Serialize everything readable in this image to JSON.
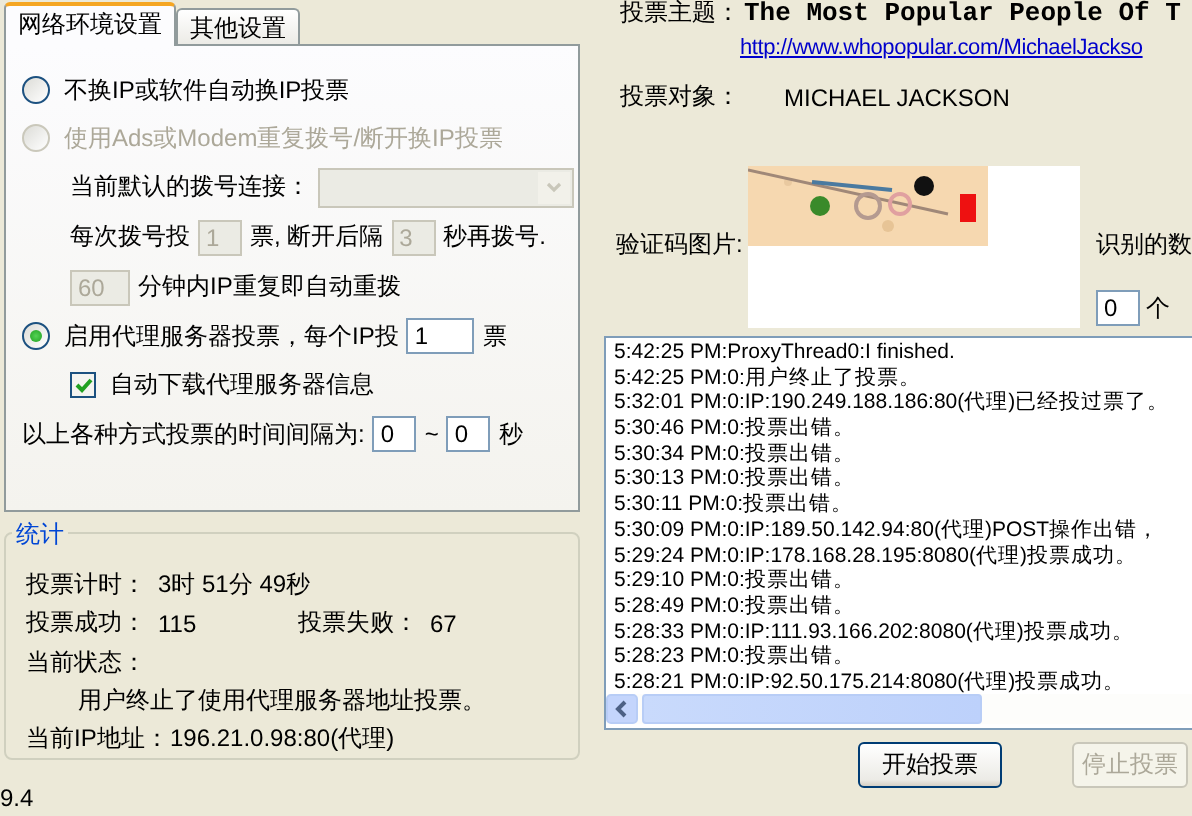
{
  "settings_tabs": [
    {
      "label": "网络环境设置",
      "selected": true
    },
    {
      "label": "其他设置",
      "selected": false
    }
  ],
  "network_settings": [
    {
      "kind": "radio",
      "selected": false,
      "disabled": false,
      "parts": [
        {
          "kind": "text",
          "text": "不换IP或软件自动换IP投票"
        }
      ]
    },
    {
      "kind": "radio",
      "selected": false,
      "disabled": true,
      "parts": [
        {
          "kind": "text",
          "text": "使用Ads或Modem重复拨号/断开换IP投票"
        }
      ],
      "children": [
        {
          "kind": "row",
          "parts": [
            {
              "kind": "text",
              "text": "当前默认的拨号连接："
            },
            {
              "kind": "select",
              "disabled": true
            }
          ]
        },
        {
          "kind": "row",
          "parts": [
            {
              "kind": "text",
              "text": "每次拨号投"
            },
            {
              "kind": "input",
              "value": "1",
              "disabled": true
            },
            {
              "kind": "text",
              "text": "票, 断开后隔"
            },
            {
              "kind": "input",
              "value": "3",
              "disabled": true
            },
            {
              "kind": "text",
              "text": "秒再拨号."
            }
          ]
        },
        {
          "kind": "row",
          "parts": [
            {
              "kind": "input",
              "value": "60",
              "disabled": true
            },
            {
              "kind": "text",
              "text": "分钟内IP重复即自动重拨"
            }
          ]
        }
      ]
    },
    {
      "kind": "radio",
      "selected": true,
      "disabled": false,
      "parts": [
        {
          "kind": "text",
          "text": "启用代理服务器投票，每个IP投"
        },
        {
          "kind": "input",
          "value": "1",
          "disabled": false
        },
        {
          "kind": "text",
          "text": "票"
        }
      ],
      "children": [
        {
          "kind": "checkbox",
          "checked": true,
          "parts": [
            {
              "kind": "text",
              "text": "自动下载代理服务器信息"
            }
          ]
        }
      ]
    },
    {
      "kind": "row",
      "parts": [
        {
          "kind": "text",
          "text": "以上各种方式投票的时间间隔为:"
        },
        {
          "kind": "input",
          "value": "0",
          "disabled": false
        },
        {
          "kind": "text",
          "text": "~"
        },
        {
          "kind": "input",
          "value": "0",
          "disabled": false
        },
        {
          "kind": "text",
          "text": "秒"
        }
      ]
    }
  ],
  "stats": {
    "title": "统计",
    "timer_label": "投票计时：",
    "timer": "3时 51分 49秒",
    "success_label": "投票成功：",
    "success": "115",
    "fail_label": "投票失败：",
    "fail": "67",
    "status_label": "当前状态：",
    "status": "用户终止了使用代理服务器地址投票。",
    "ip_label": "当前IP地址：",
    "ip": "196.21.0.98:80(代理)"
  },
  "version": "9.4",
  "topic_label": "投票主题：",
  "topic": "The Most Popular People Of T",
  "topic_link": "http://www.whopopular.com/MichaelJackso",
  "target_label": "投票对象：",
  "target": "MICHAEL JACKSON",
  "captcha_label": "验证码图片:",
  "recognized_label": "识别的数",
  "digit_count": "0",
  "digit_label": "个",
  "log": [
    "5:42:25 PM:ProxyThread0:I finished.",
    "5:42:25 PM:0:用户终止了投票。",
    "5:32:01 PM:0:IP:190.249.188.186:80(代理)已经投过票了。",
    "5:30:46 PM:0:投票出错。",
    "5:30:34 PM:0:投票出错。",
    "5:30:13 PM:0:投票出错。",
    "5:30:11 PM:0:投票出错。",
    "5:30:09 PM:0:IP:189.50.142.94:80(代理)POST操作出错，",
    "5:29:24 PM:0:IP:178.168.28.195:8080(代理)投票成功。",
    "5:29:10 PM:0:投票出错。",
    "5:28:49 PM:0:投票出错。",
    "5:28:33 PM:0:IP:111.93.166.202:8080(代理)投票成功。",
    "5:28:23 PM:0:投票出错。",
    "5:28:21 PM:0:IP:92.50.175.214:8080(代理)投票成功。"
  ],
  "buttons": [
    {
      "label": "开始投票",
      "disabled": false
    },
    {
      "label": "停止投票",
      "disabled": true
    }
  ]
}
